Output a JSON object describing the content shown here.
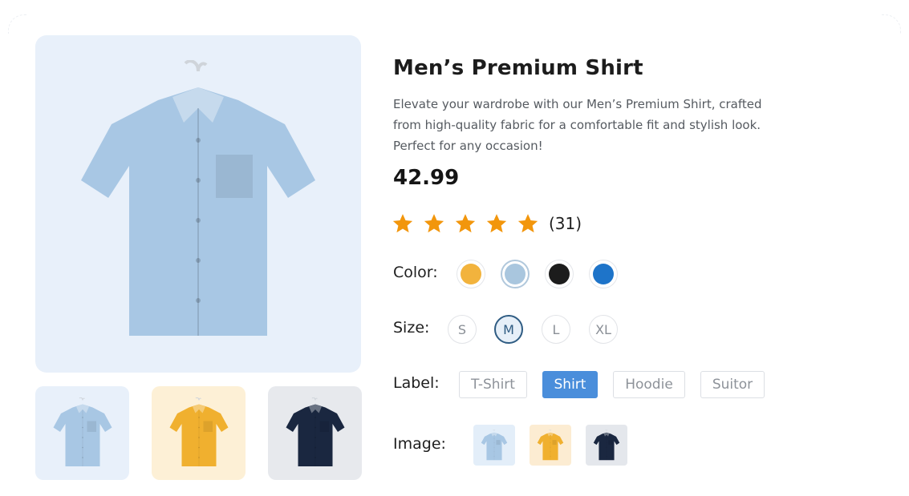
{
  "product": {
    "title": "Men’s Premium Shirt",
    "description": "Elevate your wardrobe with our Men’s Premium Shirt, crafted from high-quality fabric for a comfortable fit and stylish look. Perfect for any occasion!",
    "price": "42.99",
    "rating": {
      "stars": 5,
      "count": "(31)"
    }
  },
  "gallery": {
    "main_image": "light-blue-shirt",
    "thumbnails": [
      "light-blue-shirt",
      "yellow-shirt",
      "navy-shirt"
    ]
  },
  "options": {
    "color_label": "Color:",
    "colors": [
      {
        "name": "yellow",
        "hex": "#f2b33d"
      },
      {
        "name": "light-blue",
        "hex": "#a9c6de",
        "selected": true
      },
      {
        "name": "black",
        "hex": "#1c1c1c"
      },
      {
        "name": "blue",
        "hex": "#1e74c9"
      }
    ],
    "size_label": "Size:",
    "sizes": [
      "S",
      "M",
      "L",
      "XL"
    ],
    "selected_size": "M",
    "label_label": "Label:",
    "labels": [
      "T-Shirt",
      "Shirt",
      "Hoodie",
      "Suitor"
    ],
    "selected_label": "Shirt",
    "image_label": "Image:",
    "images": [
      "light-blue-shirt",
      "yellow-shirt",
      "navy-shirt"
    ]
  },
  "colors": {
    "accent": "#4a8edb",
    "star": "#f2960c",
    "shirt_blue": "#a8c7e4",
    "shirt_yellow": "#f0b02f",
    "shirt_navy": "#1a2740"
  }
}
